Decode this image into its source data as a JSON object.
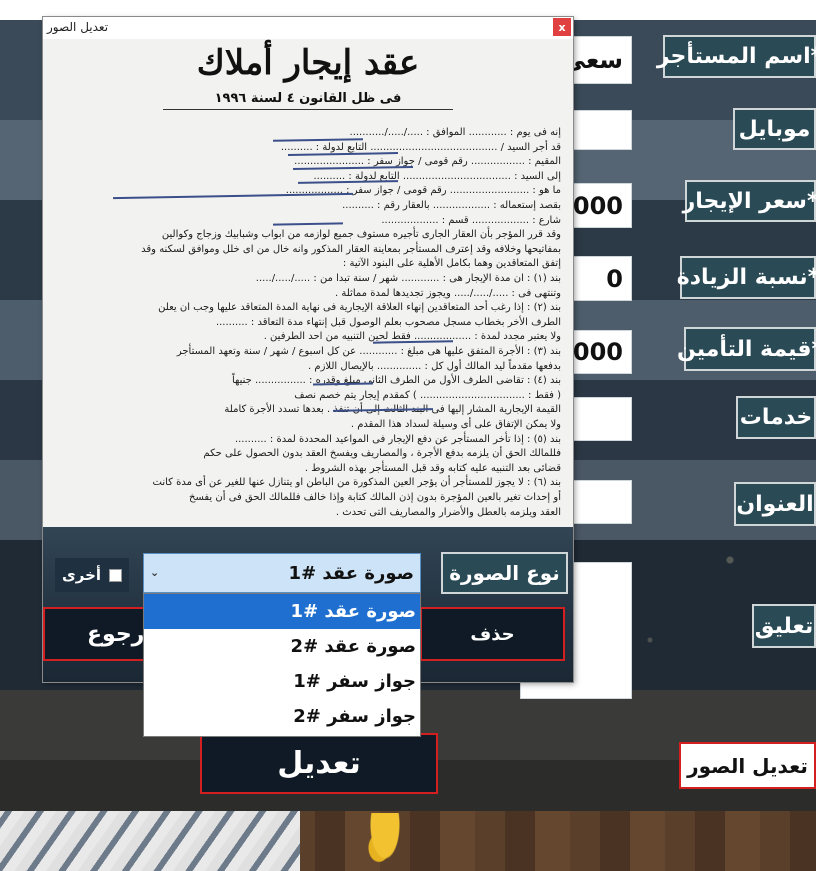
{
  "form": {
    "tenant_name_label": "اسم المستأجر*",
    "tenant_name_value": "سعي",
    "mobile_label": "موبايل",
    "mobile_value": "",
    "rent_price_label": "سعر الإيجار*",
    "rent_price_value": "2000",
    "increase_rate_label": "نسبة الزيادة*",
    "increase_rate_value": "0",
    "deposit_label": "قيمة التأمين*",
    "deposit_value": "2000",
    "services_label": "خدمات",
    "services_value": "",
    "address_label": "العنوان",
    "address_value": "",
    "comment_label": "تعليق",
    "comment_value": "",
    "edit_images_button": "تعديل الصور",
    "edit_button": "تعديل"
  },
  "dialog": {
    "title": "تعديل الصور",
    "close": "x",
    "document": {
      "title": "عقد إيجار أملاك",
      "subtitle": "فى ظل القانون ٤ لسنة ١٩٩٦",
      "lines": [
        "إنه فى يوم : ............ الموافق : ...../...../...........",
        "قد أجر السيد / ........................................ التابع لدولة : ..........",
        "المقيم : ................. رقم قومى / جواز سفر : ......................",
        "إلى السيد : .................................. التابع لدولة : ..........",
        "ما هو : ......................... رقم قومى / جواز سفر : ..................",
        "بقصد إستعماله : .................. بالعقار رقم : ..........",
        "شارع : .................. قسم : ..................",
        "وقد قرر المؤجر بأن العقار الجارى تأجيره مستوف جميع لوازمه من ابواب وشبابيك وزجاج وكوالين",
        "بمفاتيحها وخلافه وقد إعترف المستأجر بمعاينة العقار المذكور وانه خال من اى خلل وموافق لسكنه وقد",
        "إتفق المتعاقدين وهما بكامل الأهلية على البنود الآتية :",
        "بند (١) : ان مدة الإيجار هى : ............ شهر / سنة تبدا من : ...../...../.....",
        "وتنتهى فى : ...../...../..... ويجوز تجديدها لمدة مماثلة .",
        "بند (٢) : إذا رغب أحد المتعاقدين إنهاء العلاقة الإيجارية فى نهاية المدة المتعاقد عليها وجب ان يعلن",
        "الطرف الأخر بخطاب مسجل مصحوب بعلم الوصول قبل إنتهاء مدة التعاقد : ..........",
        "ولا يعتبر مجدد لمدة : .................. فقط لحين التنبيه من احد الطرفين .",
        "بند (٣) : الأجرة المتفق عليها هى مبلغ : ............ عن كل اسبوع / شهر / سنة وتعهد المستأجر",
        "بدفعها مقدماً ليد المالك أول كل : .............. بالإيصال اللازم .",
        "بند (٤) : تقاضى الطرف الأول من الطرف الثانى مبلغ وقدره : ................ جنيهاً",
        "( فقط : ................................. ) كمقدم إيجار يتم خصم نصف",
        "القيمة الإيجارية المشار إليها فى البند الثالث إلى أن تنفذ . بعدها تسدد الأجرة كاملة",
        "ولا يمكن الإتفاق على أى وسيلة لسداد هذا المقدم .",
        "بند (٥) : إذا تأخر المستأجر عن دفع الإيجار فى المواعيد المحددة لمدة : ..........",
        "فللمالك الحق أن يلزمه بدفع الأجرة ، والمصاريف ويفسخ العقد بدون الحصول على حكم",
        "قضائى بعد التنبيه عليه كتابه وقد قبل المستأجر بهذه الشروط .",
        "بند (٦) : لا يجوز للمستأجر أن يؤجر العين المذكورة من الباطن او يتنازل عنها للغير عن أى مدة كانت",
        "أو إحداث تغير بالعين المؤجرة بدون إذن المالك كتابة وإذا خالف فللمالك الحق فى أن يفسخ",
        "العقد ويلزمه بالعطل والأضرار والمصاريف التى تحدث ."
      ]
    },
    "image_type_label": "نوع الصورة",
    "other_label": "أخرى",
    "selected_type": "صورة عقد #1",
    "type_options": [
      "صورة عقد #1",
      "صورة عقد #2",
      "جواز سفر #1",
      "جواز سفر #2"
    ],
    "delete_button": "حذف",
    "back_button": "رجوع"
  }
}
